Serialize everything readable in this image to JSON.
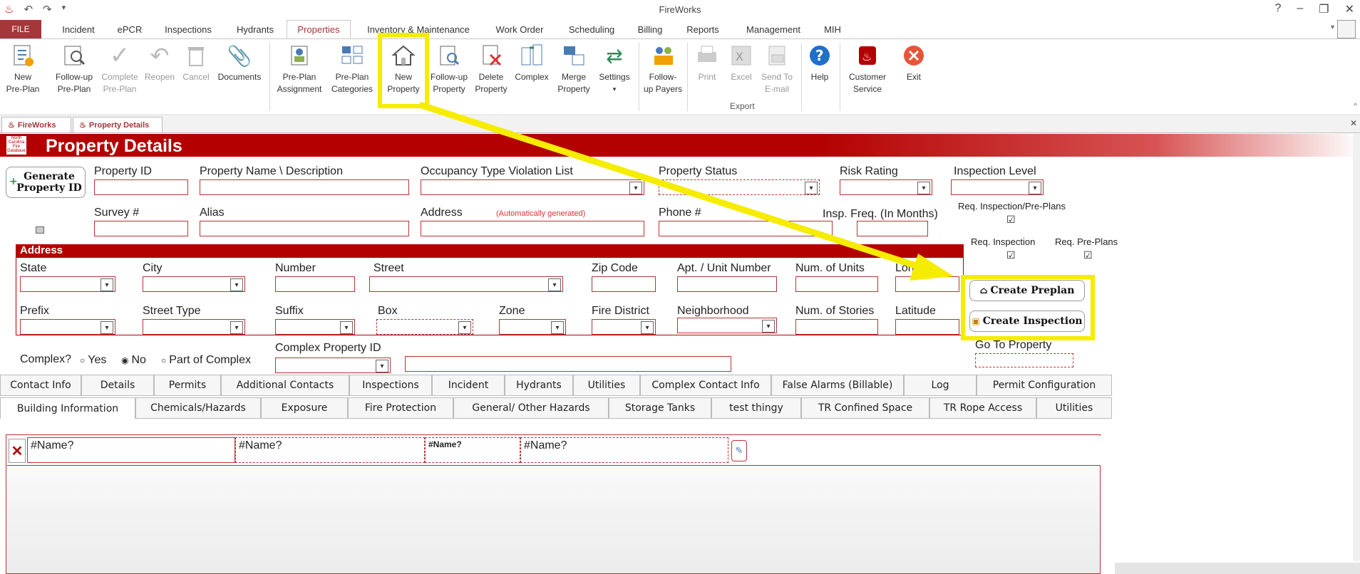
{
  "app": {
    "title": "FireWorks"
  },
  "menu": {
    "file": "FILE",
    "tabs": [
      "Incident",
      "ePCR",
      "Inspections",
      "Hydrants",
      "Properties",
      "Inventory & Maintenance",
      "Work Order",
      "Scheduling",
      "Billing",
      "Reports",
      "Management",
      "MIH"
    ],
    "active": "Properties"
  },
  "ribbon": {
    "new_preplan": [
      "New",
      "Pre-Plan"
    ],
    "followup_preplan": [
      "Follow-up",
      "Pre-Plan"
    ],
    "complete_preplan": [
      "Complete",
      "Pre-Plan"
    ],
    "reopen": "Reopen",
    "cancel": "Cancel",
    "documents": "Documents",
    "preplan_assignment": [
      "Pre-Plan",
      "Assignment"
    ],
    "preplan_categories": [
      "Pre-Plan",
      "Categories"
    ],
    "new_property": [
      "New",
      "Property"
    ],
    "followup_property": [
      "Follow-up",
      "Property"
    ],
    "delete_property": [
      "Delete",
      "Property"
    ],
    "complex": "Complex",
    "merge_property": [
      "Merge",
      "Property"
    ],
    "settings": "Settings",
    "followup_payers": [
      "Follow-",
      "up Payers"
    ],
    "print": "Print",
    "excel": "Excel",
    "send_email": [
      "Send To",
      "E-mail"
    ],
    "export_group": "Export",
    "help": "Help",
    "customer_service": [
      "Customer",
      "Service"
    ],
    "exit": "Exit"
  },
  "doctabs": [
    "FireWorks",
    "Property Details"
  ],
  "header": {
    "title": "Property Details",
    "logo_text": "North Carolina Fire Database"
  },
  "form": {
    "generate_btn": [
      "Generate",
      "Property ID"
    ],
    "property_id": "Property ID",
    "property_name": "Property Name \\ Description",
    "occupancy_type": "Occupancy Type Violation List",
    "property_status": "Property Status",
    "risk_rating": "Risk Rating",
    "inspection_level": "Inspection Level",
    "survey": "Survey  #",
    "alias": "Alias",
    "address": "Address",
    "address_note": "(Automatically generated)",
    "phone": "Phone #",
    "insp_freq": "Insp. Freq. (In Months)",
    "req_insp_preplans": "Req. Inspection/Pre-Plans",
    "req_inspection": "Req. Inspection",
    "req_preplans": "Req. Pre-Plans",
    "check_mark": "☑"
  },
  "address_section": {
    "title": "Address",
    "state": "State",
    "city": "City",
    "number": "Number",
    "street": "Street",
    "zip": "Zip Code",
    "apt": "Apt. / Unit Number",
    "num_units": "Num. of Units",
    "longitude": "Lon      de",
    "prefix": "Prefix",
    "street_type": "Street Type",
    "suffix": "Suffix",
    "box": "Box",
    "zone": "Zone",
    "fire_district": "Fire District",
    "neighborhood": "Neighborhood",
    "num_stories": "Num. of Stories",
    "latitude": "Latitude"
  },
  "buttons": {
    "create_preplan": "Create Preplan",
    "create_inspection": "Create Inspection",
    "go_to_property": "Go To Property"
  },
  "complex": {
    "question": "Complex?",
    "yes": "Yes",
    "no": "No",
    "part": "Part of Complex",
    "complex_id": "Complex Property ID"
  },
  "tabs_row1": [
    "Contact Info",
    "Details",
    "Permits",
    "Additional Contacts",
    "Inspections",
    "Incident",
    "Hydrants",
    "Utilities",
    "Complex Contact Info",
    "False Alarms (Billable)",
    "Log",
    "Permit Configuration"
  ],
  "tabs_row2": [
    "Building Information",
    "Chemicals/Hazards",
    "Exposure",
    "Fire Protection",
    "General/ Other Hazards",
    "Storage Tanks",
    "test thingy",
    "TR Confined Space",
    "TR Rope Access",
    "Utilities"
  ],
  "subform": {
    "cells": [
      "#Name?",
      "#Name?",
      "#Name?",
      "#Name?"
    ]
  },
  "colors": {
    "brand": "#b30000",
    "highlight": "#f5ec00"
  }
}
